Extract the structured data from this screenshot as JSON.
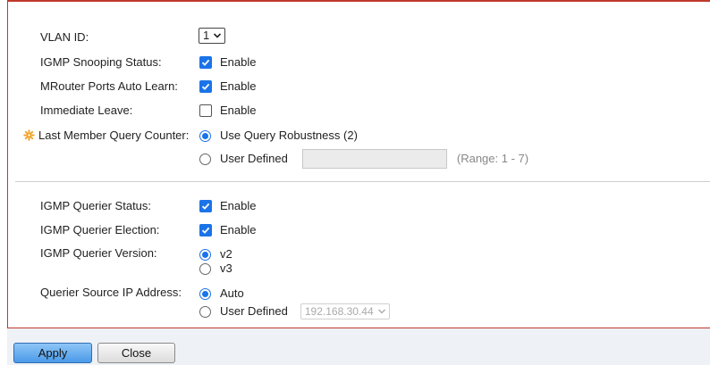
{
  "form": {
    "vlan_id": {
      "label": "VLAN ID:",
      "value": "1"
    },
    "snooping_status": {
      "label": "IGMP Snooping Status:",
      "option": "Enable",
      "checked": true
    },
    "mrouter_auto_learn": {
      "label": "MRouter Ports Auto Learn:",
      "option": "Enable",
      "checked": true
    },
    "immediate_leave": {
      "label": "Immediate Leave:",
      "option": "Enable",
      "checked": false
    },
    "last_member_query": {
      "label": "Last Member Query Counter:",
      "option1": "Use Query Robustness (2)",
      "option2": "User Defined",
      "range": "(Range: 1 - 7)",
      "selected": "option1"
    },
    "querier_status": {
      "label": "IGMP Querier Status:",
      "option": "Enable",
      "checked": true
    },
    "querier_election": {
      "label": "IGMP Querier Election:",
      "option": "Enable",
      "checked": true
    },
    "querier_version": {
      "label": "IGMP Querier Version:",
      "option1": "v2",
      "option2": "v3",
      "selected": "v2"
    },
    "querier_source_ip": {
      "label": "Querier Source IP Address:",
      "option1": "Auto",
      "option2": "User Defined",
      "ip_value": "192.168.30.44",
      "selected": "Auto"
    }
  },
  "buttons": {
    "apply": "Apply",
    "close": "Close"
  },
  "colors": {
    "accent": "#1a73e8",
    "frame_border": "#c0392b",
    "required_star": "#f0a020"
  }
}
